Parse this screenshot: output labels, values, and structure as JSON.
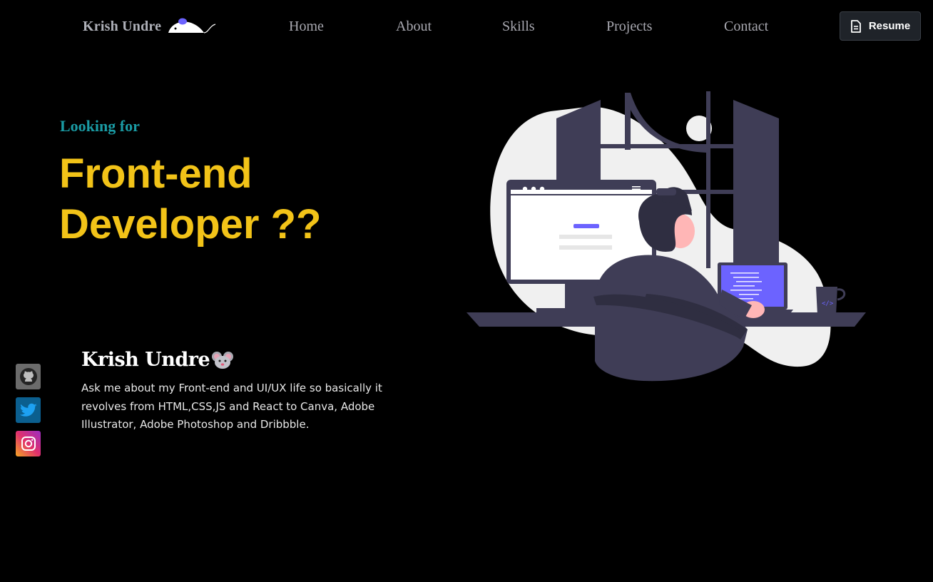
{
  "nav": {
    "brand": "Krish Undre",
    "links": [
      "Home",
      "About",
      "Skills",
      "Projects",
      "Contact"
    ],
    "resume_label": "Resume"
  },
  "hero": {
    "kicker": "Looking for",
    "headline_line1": "Front-end",
    "headline_line2": "Developer ??"
  },
  "bio": {
    "name": "Krish Undre",
    "description": "Ask me about my Front-end and UI/UX life so basically it revolves from HTML,CSS,JS and React to Canva, Adobe Illustrator, Adobe Photoshop and Dribbble."
  },
  "socials": [
    {
      "name": "github",
      "icon": "github-icon"
    },
    {
      "name": "twitter",
      "icon": "twitter-icon"
    },
    {
      "name": "instagram",
      "icon": "instagram-icon"
    }
  ],
  "colors": {
    "background": "#000000",
    "accent_yellow": "#f2c318",
    "accent_teal": "#1a9ba4",
    "illustration_purple": "#6c63ff",
    "illustration_dark": "#3f3d56"
  }
}
